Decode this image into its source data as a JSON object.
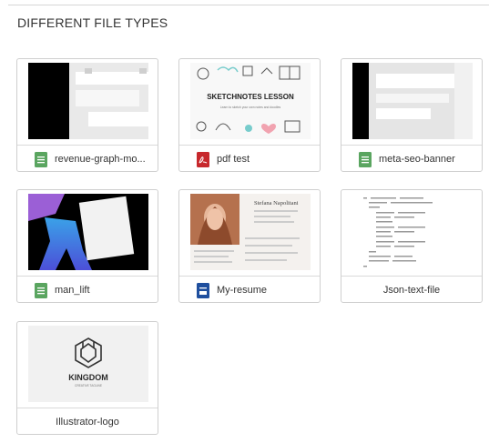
{
  "section": {
    "title": "DIFFERENT FILE TYPES"
  },
  "files": [
    {
      "name": "revenue-graph-mo...",
      "icon": "spreadsheet-icon",
      "icon_color": "#5aa560"
    },
    {
      "name": "pdf test",
      "icon": "pdf-icon",
      "icon_color": "#c7282c",
      "thumb_heading": "SKETCHNOTES LESSON",
      "thumb_sub": "Learn to sketch your own notes and doodles"
    },
    {
      "name": "meta-seo-banner",
      "icon": "spreadsheet-icon",
      "icon_color": "#5aa560"
    },
    {
      "name": "man_lift",
      "icon": "spreadsheet-icon",
      "icon_color": "#5aa560"
    },
    {
      "name": "My-resume",
      "icon": "document-icon",
      "icon_color": "#1f4f9e",
      "thumb_name": "Stefana Napolitani"
    },
    {
      "name": "Json-text-file"
    },
    {
      "name": "Illustrator-logo",
      "thumb_brand": "KINGDOM",
      "thumb_tagline": "CREATIVE TAGLINE"
    }
  ]
}
